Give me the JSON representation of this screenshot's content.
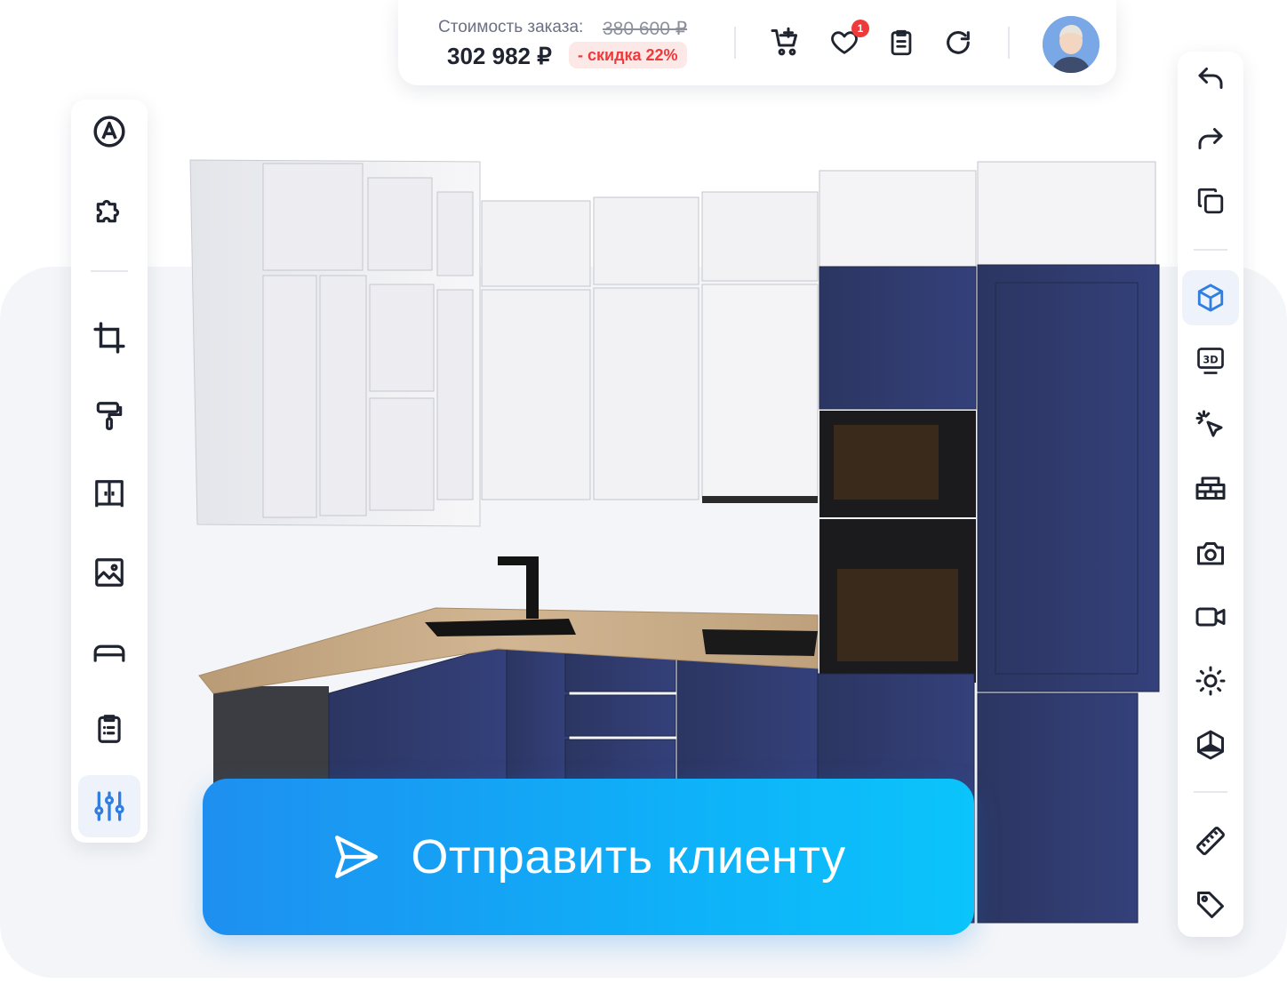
{
  "order": {
    "cost_label": "Стоимость заказа:",
    "old_price": "380 600 ₽",
    "new_price": "302 982 ₽",
    "discount": "- скидка 22%"
  },
  "topbar": {
    "icons": [
      "add-to-cart-icon",
      "heart-icon",
      "clipboard-list-icon",
      "refresh-icon"
    ],
    "favorites_badge": "1",
    "avatar": "user-avatar"
  },
  "left_toolbar": [
    "brand-logo-icon",
    "puzzle-icon",
    "crop-icon",
    "paint-roller-icon",
    "wardrobe-icon",
    "image-icon",
    "countertop-icon",
    "clipboard-list-icon",
    "sliders-icon"
  ],
  "right_toolbar": [
    "undo-icon",
    "redo-icon",
    "copy-icon",
    "cube-icon",
    "3d-view-icon",
    "select-pointer-icon",
    "brick-wall-icon",
    "camera-icon",
    "video-icon",
    "sun-icon",
    "box-corner-icon",
    "ruler-icon",
    "tag-icon"
  ],
  "actions": {
    "send_to_client": "Отправить клиенту"
  },
  "colors": {
    "accent_start": "#1e8ff0",
    "accent_end": "#0bc4fb",
    "discount": "#ee3a3a",
    "cabinet_navy": "#2f3a68",
    "cabinet_white": "#eceef2",
    "worktop": "#c7ab86"
  }
}
